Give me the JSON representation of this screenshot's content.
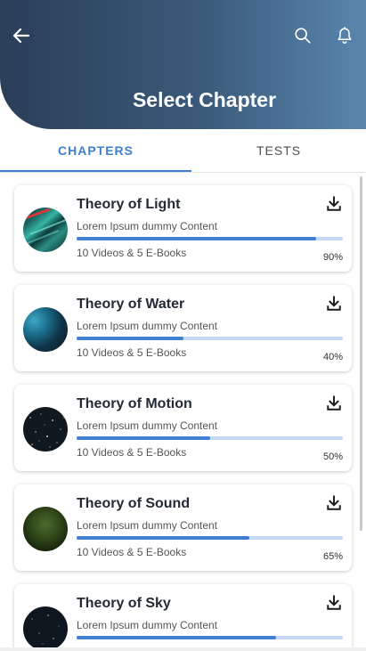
{
  "header": {
    "title": "Select Chapter",
    "back_icon": "arrow-left-icon",
    "search_icon": "search-icon",
    "notification_icon": "bell-icon"
  },
  "tabs": [
    {
      "label": "CHAPTERS",
      "active": true
    },
    {
      "label": "TESTS",
      "active": false
    }
  ],
  "colors": {
    "accent": "#3f7fd0",
    "header_dark": "#2a3e57",
    "header_light": "#5a86ae",
    "track": "#c5d8f5"
  },
  "chapters": [
    {
      "title": "Theory of Light",
      "subtitle": "Lorem Ipsum dummy Content",
      "meta": "10 Videos & 5 E-Books",
      "progress": 90,
      "progress_label": "90%"
    },
    {
      "title": "Theory of Water",
      "subtitle": "Lorem Ipsum dummy Content",
      "meta": "10 Videos & 5 E-Books",
      "progress": 40,
      "progress_label": "40%"
    },
    {
      "title": "Theory of Motion",
      "subtitle": "Lorem Ipsum dummy Content",
      "meta": "10 Videos & 5 E-Books",
      "progress": 50,
      "progress_label": "50%"
    },
    {
      "title": "Theory of Sound",
      "subtitle": "Lorem Ipsum dummy Content",
      "meta": "10 Videos & 5 E-Books",
      "progress": 65,
      "progress_label": "65%"
    },
    {
      "title": "Theory of Sky",
      "subtitle": "Lorem Ipsum dummy Content",
      "meta": "",
      "progress": 75,
      "progress_label": ""
    }
  ]
}
